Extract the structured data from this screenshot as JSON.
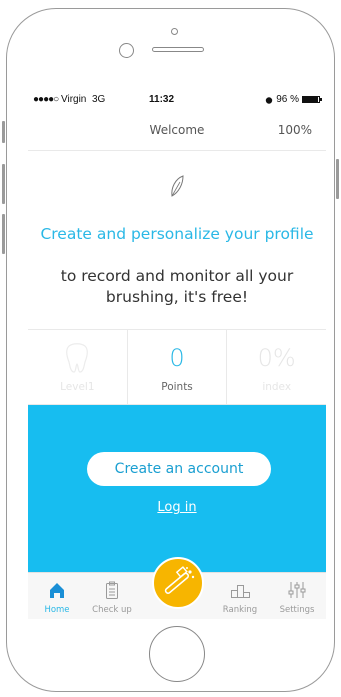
{
  "status_bar": {
    "signal_dots": "●●●●○",
    "carrier": "Virgin",
    "network": "3G",
    "time": "11:32",
    "battery_percent": "96 %",
    "battery_level": 0.96
  },
  "nav": {
    "title": "Welcome",
    "progress": "100%"
  },
  "intro": {
    "headline": "Create and personalize your profile",
    "subline": "to record and monitor all your brushing, it's free!"
  },
  "stats": [
    {
      "value": "",
      "label": "Level1",
      "icon": "tooth-icon"
    },
    {
      "value": "0",
      "label": "Points"
    },
    {
      "value": "0%",
      "label": "index"
    }
  ],
  "cta": {
    "create_account": "Create an account",
    "login": "Log in"
  },
  "tabbar": {
    "home": "Home",
    "checkup": "Check up",
    "ranking": "Ranking",
    "settings": "Settings",
    "center_icon": "toothbrush-icon"
  },
  "colors": {
    "accent": "#2ab8e6",
    "cta_background": "#17bdf0",
    "fab": "#f7b500"
  }
}
